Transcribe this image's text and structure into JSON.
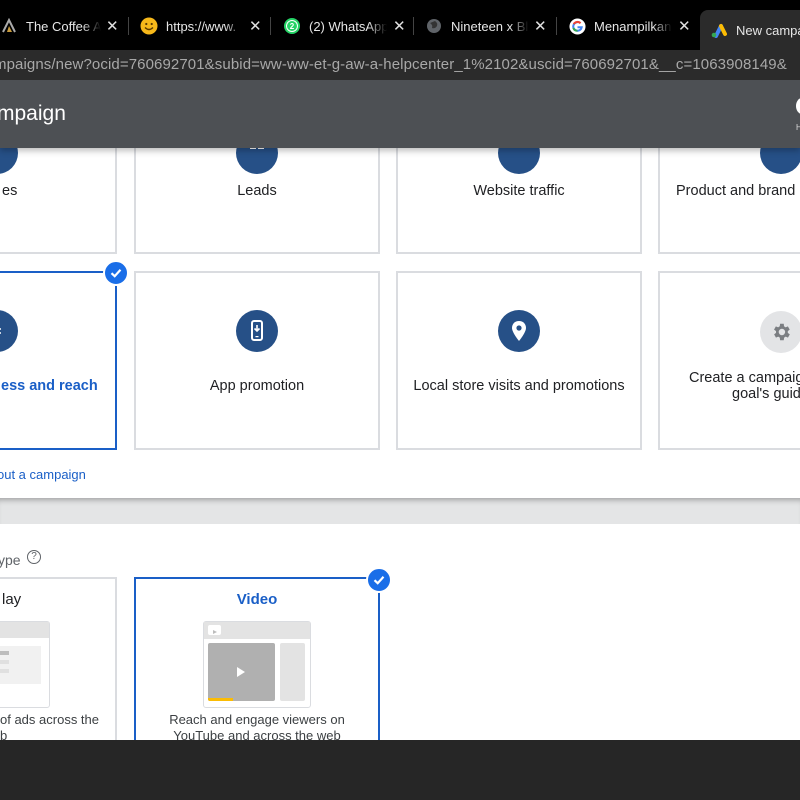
{
  "browser": {
    "tabs": [
      {
        "title": "The Coffee A",
        "icon": "coffee-logo-icon"
      },
      {
        "title": "https://www.",
        "icon": "smiley-icon"
      },
      {
        "title": "(2) WhatsApp",
        "icon": "whatsapp-icon",
        "badge": "2"
      },
      {
        "title": "Nineteen x Bl",
        "icon": "globe-icon"
      },
      {
        "title": "Menampilkan",
        "icon": "google-icon"
      },
      {
        "title": "New campaign",
        "icon": "google-ads-icon",
        "active": true
      }
    ],
    "close_glyph": "✕",
    "url": "mpaigns/new?ocid=760692701&subid=ww-ww-et-g-aw-a-helpcenter_1%2102&uscid=760692701&__c=1063908149&"
  },
  "header": {
    "title": "mpaign",
    "help_label": "H"
  },
  "objectives": [
    {
      "label": "es",
      "icon": "sales-icon",
      "selected": false
    },
    {
      "label": "Leads",
      "icon": "leads-icon",
      "selected": false
    },
    {
      "label": "Website traffic",
      "icon": "website-traffic-icon",
      "selected": false
    },
    {
      "label": "Product and brand c",
      "icon": "product-brand-icon",
      "selected": false
    },
    {
      "label": "ess and reach",
      "icon": "awareness-icon",
      "selected": true
    },
    {
      "label": "App promotion",
      "icon": "phone-download-icon",
      "selected": false
    },
    {
      "label": "Local store visits and promotions",
      "icon": "location-pin-icon",
      "selected": false
    },
    {
      "label": "Create a campaign without a goal's guidance",
      "label_lines": [
        "Create a campaig",
        "goal's guid"
      ],
      "icon": "gear-icon",
      "selected": false
    }
  ],
  "learn_link": "out a campaign",
  "campaign_type": {
    "label": "ype",
    "help_glyph": "?",
    "types": [
      {
        "title": "lay",
        "desc_lines": [
          "of ads across the",
          "b"
        ],
        "selected": false
      },
      {
        "title": "Video",
        "desc_lines": [
          "Reach and engage viewers on",
          "YouTube and across the web"
        ],
        "selected": true
      }
    ]
  },
  "colors": {
    "accent": "#1a5fc7",
    "icon_circle": "#265087",
    "header_bg": "#4d5054",
    "check_bg": "#1a6ee8",
    "highlight": "#fbbc04"
  }
}
